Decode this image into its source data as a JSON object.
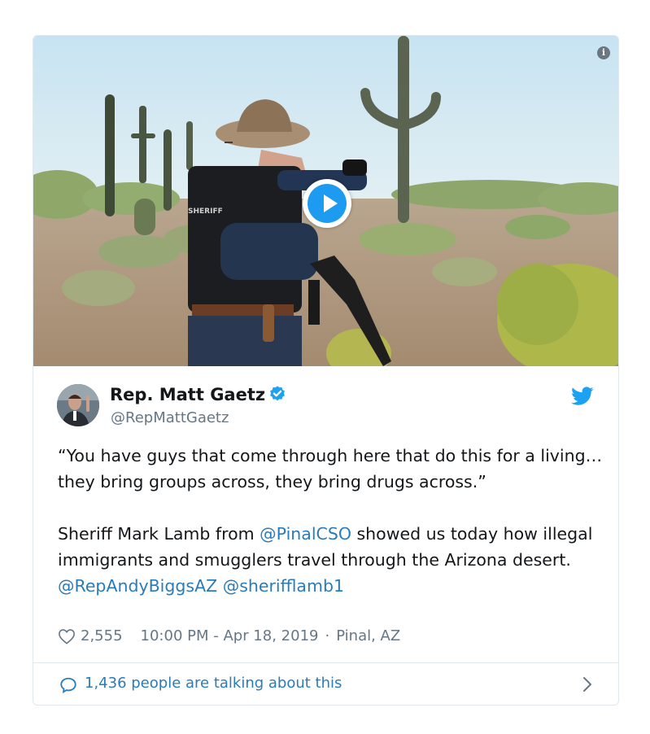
{
  "tweet": {
    "author_name": "Rep. Matt Gaetz",
    "author_handle": "@RepMattGaetz",
    "quote": "“You have guys that come through here that do this for a living…they bring groups across, they bring drugs across.”",
    "body_pre": "Sheriff Mark Lamb from ",
    "mention_1": "@PinalCSO",
    "body_mid": " showed us today how illegal immigrants and smugglers travel through the Arizona desert. ",
    "mention_2": "@RepAndyBiggsAZ",
    "mention_3": "@sherifflamb1",
    "likes": "2,555",
    "time": "10:00 PM - Apr 18, 2019",
    "separator": "·",
    "location": "Pinal, AZ",
    "talking": "1,436 people are talking about this"
  },
  "icons": {
    "info": "info-icon",
    "play": "play-icon",
    "verified": "verified-badge-icon",
    "bird": "twitter-bird-icon",
    "heart": "heart-icon",
    "bubble": "comment-bubble-icon",
    "chevron": "chevron-right-icon"
  },
  "colors": {
    "link": "#2b7bb9",
    "twitter_blue": "#1da1f2",
    "muted": "#657786",
    "text": "#14171a"
  }
}
